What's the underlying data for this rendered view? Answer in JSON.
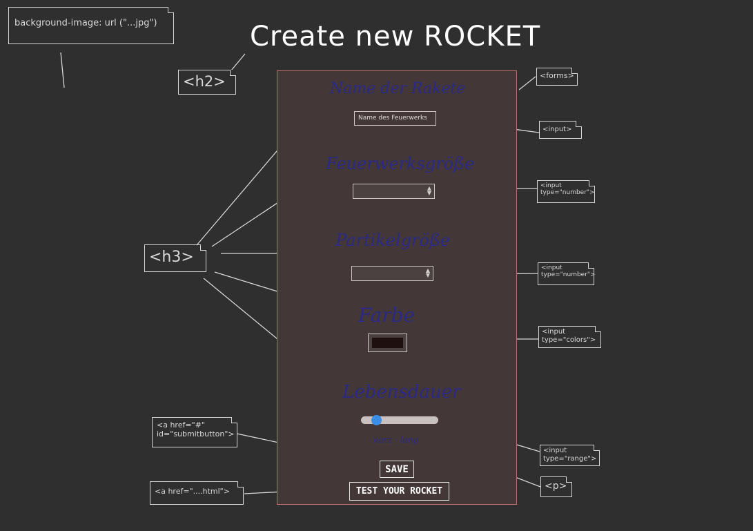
{
  "title": "Create new ROCKET",
  "tags": {
    "background": "background-image: url (\"...jpg\")",
    "h2": "<h2>",
    "forms": "<forms>",
    "h3": "<h3>",
    "input_text": "<input>",
    "input_number_1": "<input\ntype=\"number\">",
    "input_number_2": "<input\ntype=\"number\">",
    "input_color": "<input\ntype=\"colors\">",
    "input_range": "<input\ntype=\"range\">",
    "p": "<p>",
    "a_submit": "<a href=\"#\"\nid=\"submitbutton\">",
    "a_html": "<a href=\"....html\">"
  },
  "form": {
    "h3_name": "Name der Rakete",
    "name_placeholder": "Name des Feuerwerks",
    "h3_size": "Feuerwerksgröße",
    "h3_particle": "Partikelgröße",
    "h3_color": "Farbe",
    "h3_life": "Lebensdauer",
    "range_label": "kurz - lang",
    "range_value": 0.15,
    "color_value": "#1f1010",
    "save_label": "SAVE",
    "test_label": "TEST YOUR ROCKET"
  },
  "colors": {
    "background": "#2f2f2f",
    "form_bg": "#433737",
    "form_border": "#c0706c",
    "heading_ink": "#2a2a86",
    "slider_thumb": "#3a8ee6"
  }
}
